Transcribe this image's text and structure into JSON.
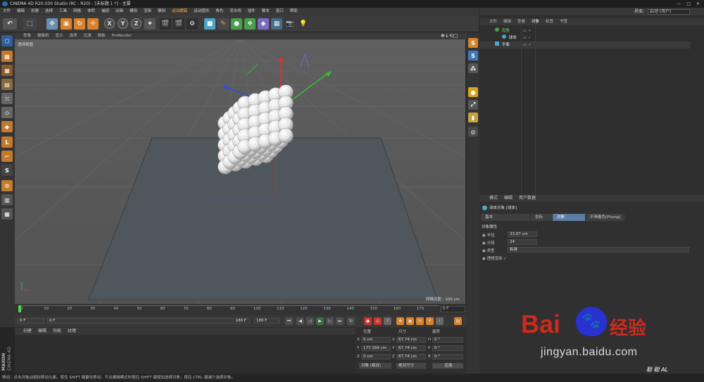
{
  "window": {
    "title": "CINEMA 4D R20.030 Studio (RC - R20) - [未标题 1 *] - 主要",
    "controls": [
      "—",
      "□",
      "✕"
    ]
  },
  "menubar": {
    "items": [
      "文件",
      "编辑",
      "创建",
      "选择",
      "工具",
      "网格",
      "体积",
      "捕捉",
      "动画",
      "模拟",
      "渲染",
      "雕刻",
      "运动跟踪",
      "运动图形",
      "角色",
      "流水线",
      "插件",
      "脚本",
      "窗口",
      "帮助"
    ],
    "interface_label": "界面:",
    "interface_value": "启动 (用户)"
  },
  "viewport": {
    "menu": [
      "查看",
      "摄像机",
      "显示",
      "选项",
      "过滤",
      "面板",
      "ProRender"
    ],
    "label": "透视视图",
    "grid_info": "网格间距 : 100 cm"
  },
  "objects": {
    "tabs": [
      "文件",
      "编辑",
      "查看",
      "对象",
      "标签",
      "书签"
    ],
    "active_tab": "对象",
    "rows": [
      {
        "name": "克隆",
        "indent": 0
      },
      {
        "name": "球体",
        "indent": 1
      },
      {
        "name": "平面",
        "indent": 0
      }
    ]
  },
  "attributes": {
    "menu": [
      "模式",
      "编辑",
      "用户数据"
    ],
    "object_title": "球体对象 [球体]",
    "tabs": [
      "基本",
      "坐标",
      "对象",
      "平滑着色(Phong)"
    ],
    "active_tab": "对象",
    "section": "对象属性",
    "fields": [
      {
        "label": "半径",
        "value": "33.87 cm"
      },
      {
        "label": "分段",
        "value": "24"
      },
      {
        "label": "类型",
        "value": "标准"
      },
      {
        "label": "理想渲染",
        "value": "✓"
      }
    ]
  },
  "timeline": {
    "ticks": [
      "0",
      "10",
      "20",
      "30",
      "40",
      "50",
      "60",
      "70",
      "80",
      "90",
      "100",
      "110",
      "120",
      "130",
      "140",
      "150",
      "160",
      "170",
      "180"
    ],
    "end_field": "0 F"
  },
  "transport": {
    "start": "0 F",
    "current": "0 F",
    "max": "180 F",
    "end": "180 F"
  },
  "materials": {
    "tabs": [
      "创建",
      "编辑",
      "功能",
      "纹理"
    ],
    "brand": [
      "MAXON",
      "CINEMA 4D"
    ]
  },
  "coords": {
    "headers": [
      "位置",
      "尺寸",
      "旋转"
    ],
    "rows": [
      {
        "axis": "X",
        "pos": "0 cm",
        "size_axis": "X",
        "size": "67.74 cm",
        "rot_axis": "H",
        "rot": "0 °"
      },
      {
        "axis": "Y",
        "pos": "177.184 cm",
        "size_axis": "Y",
        "size": "67.74 cm",
        "rot_axis": "P",
        "rot": "0 °"
      },
      {
        "axis": "Z",
        "pos": "0 cm",
        "size_axis": "Z",
        "size": "67.74 cm",
        "rot_axis": "B",
        "rot": "0 °"
      }
    ],
    "mode": "对象 (相对)",
    "size_mode": "绝对尺寸",
    "apply": "应用"
  },
  "statusbar": {
    "text": "移动：点击并拖动鼠标移动元素。按住 SHIFT 键量化移动；节点编辑模式时按住 SHIFT 键增加选择对象；按住 CTRL 键减少选择对象。"
  },
  "watermark": {
    "brand": "Bai",
    "paw": "🐾",
    "du": "经验",
    "url": "jingyan.baidu.com",
    "signature": "聪 聪 AL"
  },
  "colors": {
    "accent": "#6b8fb4",
    "axis_x": "#e03030",
    "axis_y": "#30c030",
    "axis_z": "#3050e0",
    "baidu_red": "#de2a1c",
    "baidu_blue": "#2932e1"
  }
}
